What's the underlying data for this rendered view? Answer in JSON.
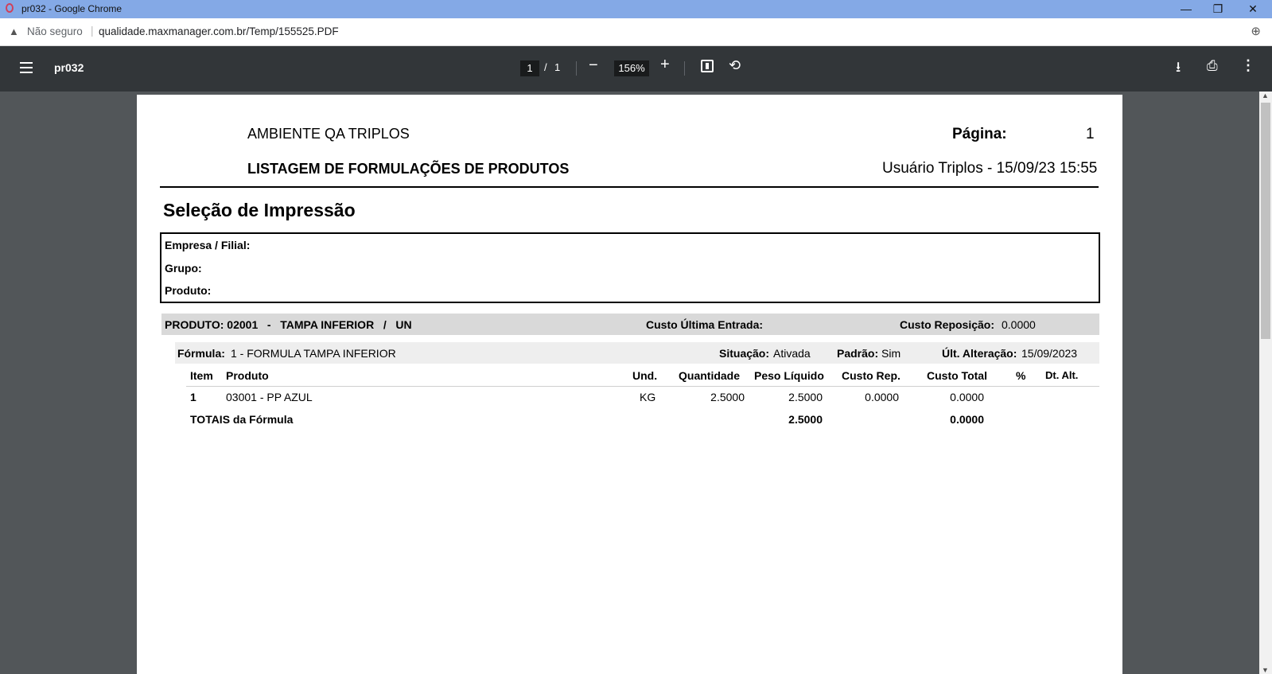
{
  "window": {
    "title": "pr032 - Google Chrome",
    "minimize": "—",
    "restore": "❐",
    "close": "✕"
  },
  "address_bar": {
    "security_label": "Não seguro",
    "url": "qualidade.maxmanager.com.br/Temp/155525.PDF"
  },
  "pdf_toolbar": {
    "doc_title": "pr032",
    "current_page": "1",
    "page_separator": "/",
    "total_pages": "1",
    "zoom": "156%"
  },
  "report": {
    "company": "AMBIENTE QA TRIPLOS",
    "page_label": "Página:",
    "page_number": "1",
    "title": "LISTAGEM DE FORMULAÇÕES DE PRODUTOS",
    "user_timestamp": "Usuário Triplos - 15/09/23 15:55",
    "selection_title": "Seleção de Impressão",
    "selection_fields": [
      "Empresa / Filial:",
      "Grupo:",
      "Produto:"
    ],
    "product": {
      "header": "PRODUTO: 02001   -   TAMPA INFERIOR   /   UN",
      "last_entry_cost_label": "Custo Última Entrada:",
      "replacement_cost_label": "Custo Reposição:",
      "replacement_cost_value": "0.0000"
    },
    "formula": {
      "label": "Fórmula:",
      "value": "1 - FORMULA TAMPA INFERIOR",
      "status_label": "Situação:",
      "status_value": "Ativada",
      "default_label": "Padrão:",
      "default_value": "Sim",
      "last_change_label": "Últ. Alteração:",
      "last_change_value": "15/09/2023"
    },
    "table": {
      "headers": {
        "item": "Item",
        "product": "Produto",
        "unit": "Und.",
        "quantity": "Quantidade",
        "net_weight": "Peso Líquido",
        "cost_rep": "Custo Rep.",
        "total_cost": "Custo Total",
        "percent": "%",
        "date_change": "Dt. Alt."
      },
      "rows": [
        {
          "item": "1",
          "product": "03001 - PP AZUL",
          "unit": "KG",
          "quantity": "2.5000",
          "net_weight": "2.5000",
          "cost_rep": "0.0000",
          "total_cost": "0.0000"
        }
      ],
      "totals": {
        "label": "TOTAIS da Fórmula",
        "net_weight": "2.5000",
        "total_cost": "0.0000"
      }
    }
  }
}
